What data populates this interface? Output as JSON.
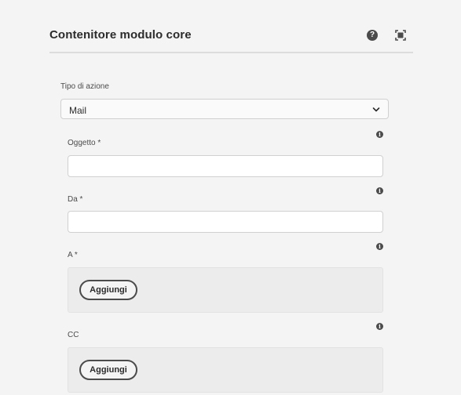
{
  "dialog": {
    "title": "Contenitore modulo core",
    "help_icon_glyph": "?",
    "help_icon": "help-icon",
    "fullscreen_icon": "fullscreen-icon"
  },
  "form": {
    "action_type": {
      "label": "Tipo di azione",
      "value": "Mail"
    },
    "subject": {
      "label": "Oggetto *",
      "value": ""
    },
    "from": {
      "label": "Da *",
      "value": ""
    },
    "to": {
      "label": "A *",
      "add_label": "Aggiungi"
    },
    "cc": {
      "label": "CC",
      "add_label": "Aggiungi"
    },
    "info_glyph": "i"
  },
  "colors": {
    "background": "#f4f4f4",
    "text": "#2c2c2c",
    "icon": "#4b4b4b"
  }
}
